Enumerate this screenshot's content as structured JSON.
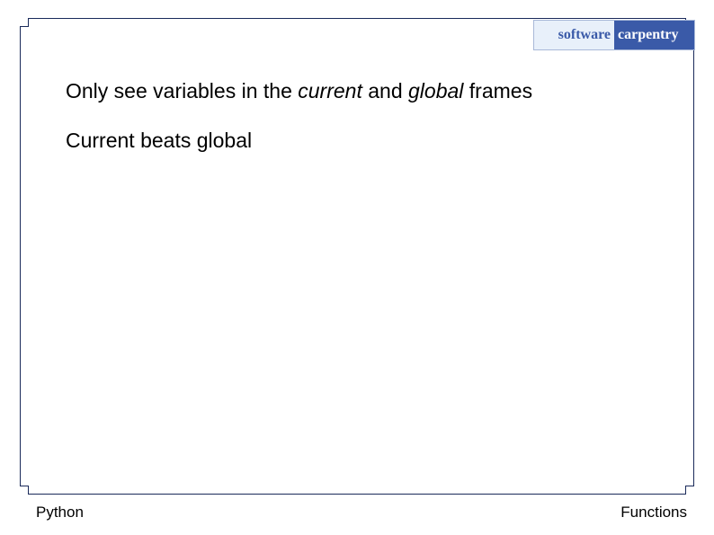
{
  "logo": {
    "word_left": "software",
    "word_right": "carpentry"
  },
  "content": {
    "line1_a": "Only see variables in the ",
    "line1_b_italic": "current",
    "line1_c": " and ",
    "line1_d_italic": "global",
    "line1_e": " frames",
    "line2": "Current beats global"
  },
  "footer": {
    "left": "Python",
    "right": "Functions"
  }
}
